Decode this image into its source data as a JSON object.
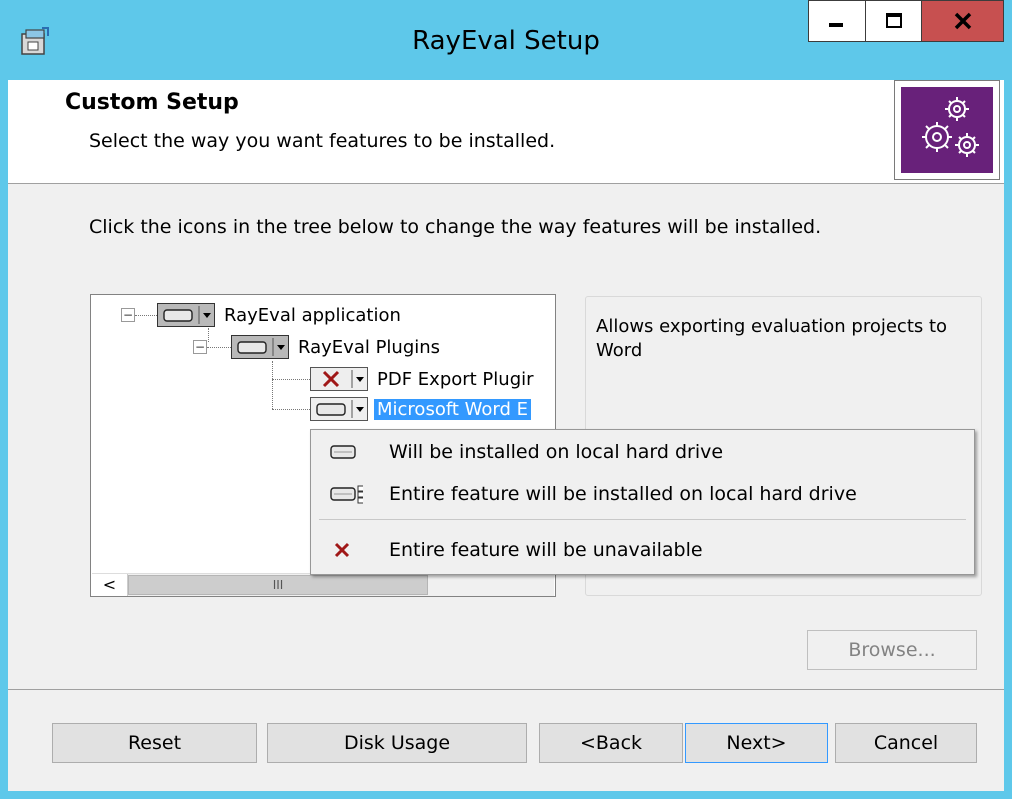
{
  "window": {
    "title": "RayEval Setup",
    "minimize_icon": "minimize-icon",
    "maximize_icon": "maximize-icon",
    "close_icon": "close-icon",
    "title_bg": "#5ec8ea",
    "close_bg": "#c75050"
  },
  "header": {
    "title": "Custom Setup",
    "subtitle": "Select the way you want features to be installed.",
    "logo_icon": "gears-icon",
    "logo_bg": "#68217a"
  },
  "instructions": "Click the icons in the tree below to change the way features will be installed.",
  "tree": {
    "items": [
      {
        "label": "RayEval application",
        "state": "installed-local",
        "expanded": true
      },
      {
        "label": "RayEval Plugins",
        "state": "installed-local",
        "expanded": true
      },
      {
        "label": "PDF Export Plugir",
        "state": "unavailable"
      },
      {
        "label": "Microsoft Word E",
        "state": "installed-local",
        "selected": true
      }
    ],
    "scroll_thumb_label": "III",
    "scroll_left_label": "<"
  },
  "description": "Allows exporting evaluation projects to Word",
  "popup_menu": {
    "items": [
      {
        "label": "Will be installed on local hard drive",
        "icon": "drive-icon"
      },
      {
        "label": "Entire feature will be installed on local hard drive",
        "icon": "drive-entire-icon"
      },
      {
        "label": "Entire feature will be unavailable",
        "icon": "red-x-icon"
      }
    ]
  },
  "buttons": {
    "browse": "Browse...",
    "reset": "Reset",
    "disk_usage": "Disk Usage",
    "back": "<Back",
    "next": "Next>",
    "cancel": "Cancel"
  }
}
